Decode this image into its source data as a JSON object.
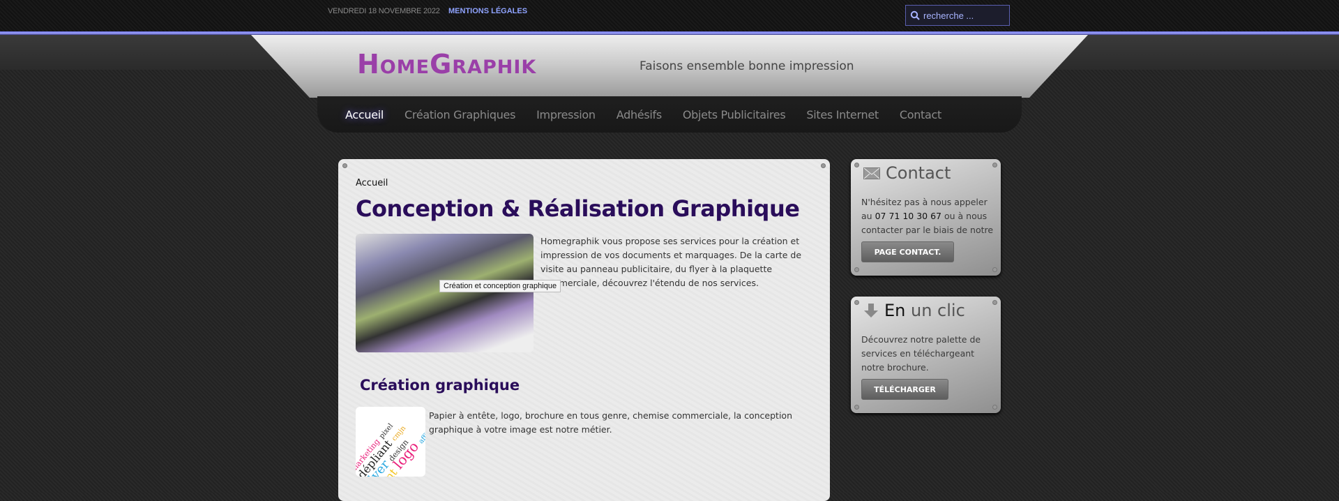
{
  "topbar": {
    "date": "VENDREDI 18 NOVEMBRE 2022",
    "mentions": "MENTIONS LÉGALES",
    "search_placeholder": "recherche ..."
  },
  "header": {
    "logo": "HomeGraphik",
    "tagline": "Faisons ensemble bonne impression"
  },
  "nav": {
    "items": [
      {
        "label": "Accueil",
        "active": true
      },
      {
        "label": "Création Graphiques"
      },
      {
        "label": "Impression"
      },
      {
        "label": "Adhésifs"
      },
      {
        "label": "Objets Publicitaires"
      },
      {
        "label": "Sites Internet"
      },
      {
        "label": "Contact"
      }
    ]
  },
  "main": {
    "breadcrumb": "Accueil",
    "title": "Conception & Réalisation Graphique",
    "intro": "Homegraphik vous propose ses services pour la création et impression de vos documents et marquages. De la carte de visite au panneau publicitaire, du flyer à la plaquette commerciale, découvrez l'étendu de nos services.",
    "tooltip": "Création et conception graphique",
    "section_title": "Création graphique",
    "section_text": "Papier à entête, logo, brochure en tous genre, chemise commerciale, la conception graphique à votre image est notre métier.",
    "wordcloud": [
      "dépliant",
      "flyer",
      "logo",
      "print",
      "design",
      "marketing",
      "pixel",
      "affiche",
      "cmjn"
    ]
  },
  "sidebar": {
    "contact": {
      "title": "Contact",
      "text_before": "N'hésitez pas à nous appeler au ",
      "phone": "07 71 10 30 67",
      "text_after": " ou à nous contacter par le biais de notre",
      "button": "PAGE CONTACT."
    },
    "download": {
      "title_a": "En",
      "title_b": " un clic",
      "text": "Découvrez notre palette de services en téléchargeant notre brochure.",
      "button": "TÉLÉCHARGER"
    }
  },
  "colors": {
    "accent": "#9a3fa8",
    "title": "#2a0d5a",
    "link": "#8fa3ff"
  }
}
